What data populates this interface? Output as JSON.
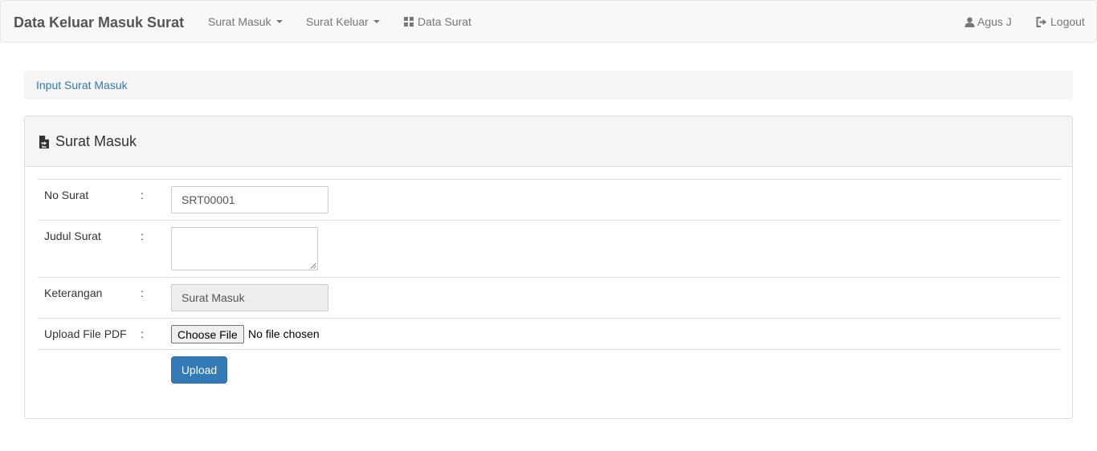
{
  "navbar": {
    "brand": "Data Keluar Masuk Surat",
    "items": [
      {
        "label": "Surat Masuk",
        "has_caret": true
      },
      {
        "label": "Surat Keluar",
        "has_caret": true
      },
      {
        "label": "Data Surat",
        "icon": "grid-icon"
      }
    ],
    "user": {
      "label": "Agus J",
      "icon": "user-icon"
    },
    "logout": {
      "label": "Logout",
      "icon": "logout-icon"
    }
  },
  "breadcrumb": {
    "label": "Input Surat Masuk"
  },
  "panel": {
    "title": "Surat Masuk",
    "icon": "file-import-icon"
  },
  "form": {
    "colon": ":",
    "no_surat": {
      "label": "No Surat",
      "value": "SRT00001"
    },
    "judul_surat": {
      "label": "Judul Surat",
      "value": ""
    },
    "keterangan": {
      "label": "Keterangan",
      "value": "Surat Masuk"
    },
    "upload_file": {
      "label": "Upload File PDF",
      "button_label": "Choose File",
      "status": "No file chosen"
    },
    "submit_label": "Upload"
  },
  "colors": {
    "primary": "#337ab7",
    "navbar_bg": "#f8f8f8",
    "link": "#337ab7"
  }
}
